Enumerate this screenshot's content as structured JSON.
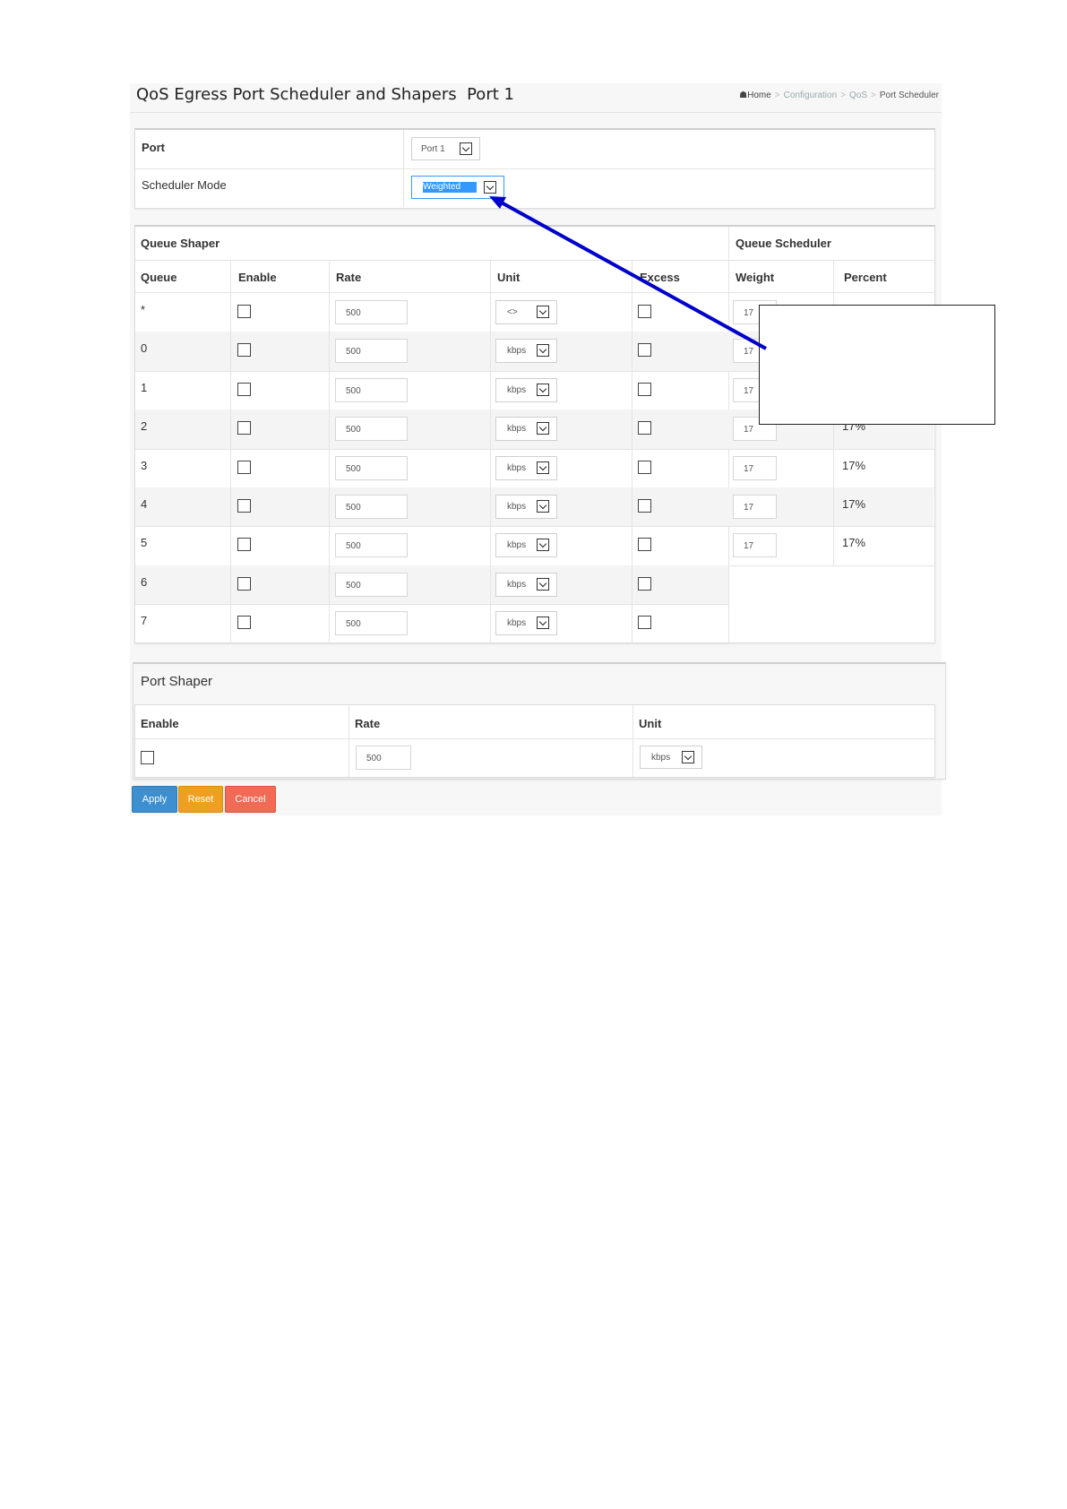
{
  "title": "QoS Egress Port Scheduler and Shapers  Port 1",
  "breadcrumb": {
    "home": "Home",
    "items": [
      "Configuration",
      "QoS",
      "Port Scheduler"
    ],
    "separator": ">"
  },
  "port_panel": {
    "port_label": "Port",
    "port_value": "Port 1",
    "mode_label": "Scheduler Mode",
    "mode_value": "Weighted"
  },
  "queue_panel": {
    "group_shaper": "Queue Shaper",
    "group_scheduler": "Queue Scheduler",
    "headers": {
      "queue": "Queue",
      "enable": "Enable",
      "rate": "Rate",
      "unit": "Unit",
      "excess": "Excess",
      "weight": "Weight",
      "percent": "Percent"
    },
    "rows": [
      {
        "queue": "*",
        "rate": "500",
        "unit": "<>",
        "weight": "17",
        "percent": ""
      },
      {
        "queue": "0",
        "rate": "500",
        "unit": "kbps",
        "weight": "17",
        "percent": ""
      },
      {
        "queue": "1",
        "rate": "500",
        "unit": "kbps",
        "weight": "17",
        "percent": ""
      },
      {
        "queue": "2",
        "rate": "500",
        "unit": "kbps",
        "weight": "17",
        "percent": "17%"
      },
      {
        "queue": "3",
        "rate": "500",
        "unit": "kbps",
        "weight": "17",
        "percent": "17%"
      },
      {
        "queue": "4",
        "rate": "500",
        "unit": "kbps",
        "weight": "17",
        "percent": "17%"
      },
      {
        "queue": "5",
        "rate": "500",
        "unit": "kbps",
        "weight": "17",
        "percent": "17%"
      },
      {
        "queue": "6",
        "rate": "500",
        "unit": "kbps"
      },
      {
        "queue": "7",
        "rate": "500",
        "unit": "kbps"
      }
    ]
  },
  "port_shaper": {
    "title": "Port Shaper",
    "headers": {
      "enable": "Enable",
      "rate": "Rate",
      "unit": "Unit"
    },
    "rate": "500",
    "unit": "kbps"
  },
  "buttons": {
    "apply": "Apply",
    "reset": "Reset",
    "cancel": "Cancel"
  },
  "colors": {
    "annotation_arrow": "#0000cc",
    "apply": "#3d8fd0",
    "reset": "#f0a020",
    "cancel": "#f06a55",
    "selected_highlight": "#3399ff"
  }
}
